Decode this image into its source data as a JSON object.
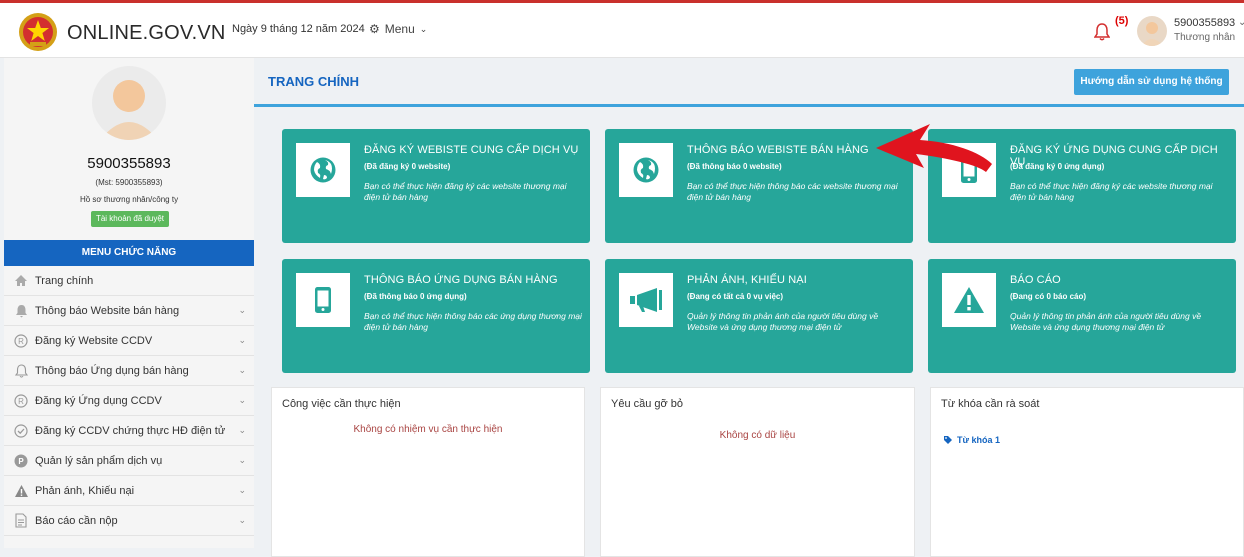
{
  "header": {
    "site_name": "ONLINE.GOV.VN",
    "date": "Ngày 9 tháng 12 năm 2024",
    "menu_label": "Menu",
    "notif_count": "(5)",
    "user_name": "5900355893",
    "user_role": "Thương nhân"
  },
  "sidebar": {
    "profile_name": "5900355893",
    "mst": "(Mst: 5900355893)",
    "profile_link": "Hồ sơ thương nhân/công ty",
    "status_badge": "Tài khoản đã duyệt",
    "menu_header": "MENU CHỨC NĂNG",
    "items": [
      {
        "label": "Trang chính",
        "icon": "home-icon"
      },
      {
        "label": "Thông báo Website bán hàng",
        "icon": "bell-icon"
      },
      {
        "label": "Đăng ký Website CCDV",
        "icon": "registered-icon"
      },
      {
        "label": "Thông báo Ứng dụng bán hàng",
        "icon": "bell-outline-icon"
      },
      {
        "label": "Đăng ký Ứng dụng CCDV",
        "icon": "registered-icon"
      },
      {
        "label": "Đăng ký CCDV chứng thực HĐ điện tử",
        "icon": "check-circle-icon"
      },
      {
        "label": "Quản lý sản phẩm dịch vụ",
        "icon": "p-circle-icon"
      },
      {
        "label": "Phản ánh, Khiếu nại",
        "icon": "warning-icon"
      },
      {
        "label": "Báo cáo cần nộp",
        "icon": "document-icon"
      }
    ]
  },
  "main": {
    "page_title": "TRANG CHÍNH",
    "guide_button": "Hướng dẫn sử dụng hệ thống",
    "cards": [
      {
        "title": "ĐĂNG KÝ WEBISTE CUNG CẤP DỊCH VỤ",
        "status": "(Đã đăng ký 0 website)",
        "desc": "Bạn có thể thực hiện đăng ký các website thương mại điện tử bán hàng",
        "icon": "globe-icon"
      },
      {
        "title": "THÔNG BÁO WEBISTE BÁN HÀNG",
        "status": "(Đã thông báo 0 website)",
        "desc": "Bạn có thể thực hiện thông báo các website thương mại điện tử bán hàng",
        "icon": "globe-icon"
      },
      {
        "title": "ĐĂNG KÝ ỨNG DỤNG CUNG CẤP DỊCH VỤ",
        "status": "(Đã đăng ký 0 ứng dụng)",
        "desc": "Bạn có thể thực hiện đăng ký các website thương mại điện tử bán hàng",
        "icon": "mobile-icon"
      },
      {
        "title": "THÔNG BÁO ỨNG DỤNG BÁN HÀNG",
        "status": "(Đã thông báo 0 ứng dụng)",
        "desc": "Bạn có thể thực hiện thông báo các ứng dụng thương mại điện tử bán hàng",
        "icon": "mobile-icon"
      },
      {
        "title": "PHẢN ÁNH, KHIẾU NẠI",
        "status": "(Đang có tất cả 0 vụ việc)",
        "desc": "Quản lý thông tin phản ánh của người tiêu dùng về Website và ứng dụng thương mại điện tử",
        "icon": "megaphone-icon"
      },
      {
        "title": "BÁO CÁO",
        "status": "(Đang có 0 báo cáo)",
        "desc": "Quản lý thông tin phản ánh của người tiêu dùng về Website và ứng dụng thương mại điện tử",
        "icon": "warning-icon"
      }
    ],
    "panels": {
      "tasks": {
        "title": "Công việc cần thực hiện",
        "empty": "Không có nhiệm vụ cần thực hiện"
      },
      "removal": {
        "title": "Yêu cầu gỡ bỏ",
        "empty": "Không có dữ liệu"
      },
      "keywords": {
        "title": "Từ khóa cần rà soát",
        "item": "Từ khóa 1"
      }
    }
  },
  "colors": {
    "card": "#26a69a",
    "primary": "#1565c0",
    "accent": "#3ea3dc",
    "badge": "#5cb85c",
    "arrow": "#e0141e"
  }
}
